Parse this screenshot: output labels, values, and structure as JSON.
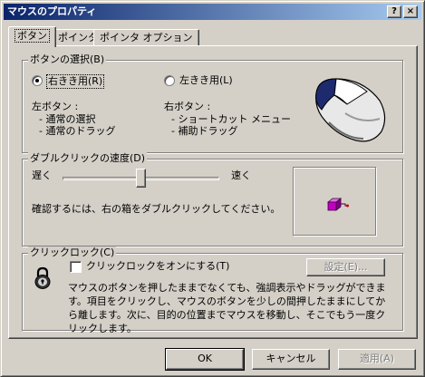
{
  "window": {
    "title": "マウスのプロパティ",
    "help_button": "?",
    "close_button": "×"
  },
  "tabs": [
    {
      "label": "ボタン",
      "active": true
    },
    {
      "label": "ポインタ",
      "active": false
    },
    {
      "label": "ポインタ オプション",
      "active": false
    }
  ],
  "button_selection": {
    "group_label": "ボタンの選択(B)",
    "right_handed": {
      "label": "右きき用(R)",
      "selected": true
    },
    "left_handed": {
      "label": "左きき用(L)",
      "selected": false
    },
    "left_button_title": "左ボタン :",
    "left_button_items": [
      "- 通常の選択",
      "- 通常のドラッグ"
    ],
    "right_button_title": "右ボタン :",
    "right_button_items": [
      "- ショートカット メニュー",
      "- 補助ドラッグ"
    ]
  },
  "double_click": {
    "group_label": "ダブルクリックの速度(D)",
    "slow_label": "遅く",
    "fast_label": "速く",
    "speed_level": 0.5,
    "hint": "確認するには、右の箱をダブルクリックしてください。"
  },
  "click_lock": {
    "group_label": "クリックロック(C)",
    "checkbox_label": "クリックロックをオンにする(T)",
    "checked": false,
    "settings_button": "設定(E)...",
    "description": "マウスのボタンを押したままでなくても、強調表示やドラッグができます。項目をクリックし、マウスのボタンを少しの間押したままにしてから離します。次に、目的の位置までマウスを移動し、そこでもう一度クリックします。"
  },
  "footer": {
    "ok": "OK",
    "cancel": "キャンセル",
    "apply": "適用(A)"
  },
  "colors": {
    "face": "#d4d0c8",
    "title_start": "#0a246a",
    "title_end": "#a6caf0",
    "test_box_magenta": "#c000c0"
  },
  "icons": {
    "mouse": "mouse-illustration-icon",
    "lock": "padlock-icon",
    "jack_in_box": "jack-in-the-box-icon"
  }
}
